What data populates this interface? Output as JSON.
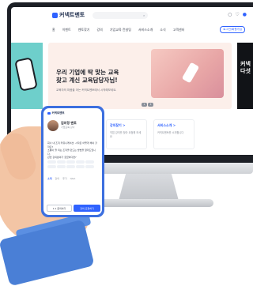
{
  "site": {
    "logo_text": "커넥트멘토",
    "nav": [
      "홈",
      "이벤트",
      "멘토찾기",
      "강의",
      "기업교육 컨설팅",
      "서비스소개",
      "소식",
      "고객센터"
    ],
    "nav_button": "로그인/회원가입",
    "search_icon": "search-icon"
  },
  "hero": {
    "title": "우리 기업에 딱 맞는 교육\n찾고 계신 교육담당자님!",
    "subtitle": "교육자의 마음을 아는 커넥트멘토에서 시작해보세요.",
    "pager": [
      "1",
      "3"
    ],
    "right_title": "커넥\n다섯"
  },
  "cards": [
    {
      "title": "강의찾기 >",
      "desc": "직접 강의를 찾아 요청해 보세요"
    },
    {
      "title": "서비스소개 >",
      "desc": "커넥트멘토를 소개합니다"
    }
  ],
  "phone": {
    "logo_text": "커넥트멘토",
    "name": "김미정 멘토",
    "role": "기업교육 강사",
    "question": "회사 내 조직 커뮤니케이션, 시작은 어떻게 해야 할까요?\n소통이 잘 되는 조직을 만드는 방법을 알려드립니다.",
    "tags_title": "관련 강의분야가 궁금하다면?",
    "tabs": [
      "소개",
      "강의",
      "후기",
      "Q&A"
    ],
    "btn_secondary": "1:1 문의하기",
    "btn_primary": "강의 요청하기"
  },
  "colors": {
    "accent": "#2f62ff",
    "hero_bg": "#fcefea",
    "sleeve": "#4a7fd6"
  }
}
